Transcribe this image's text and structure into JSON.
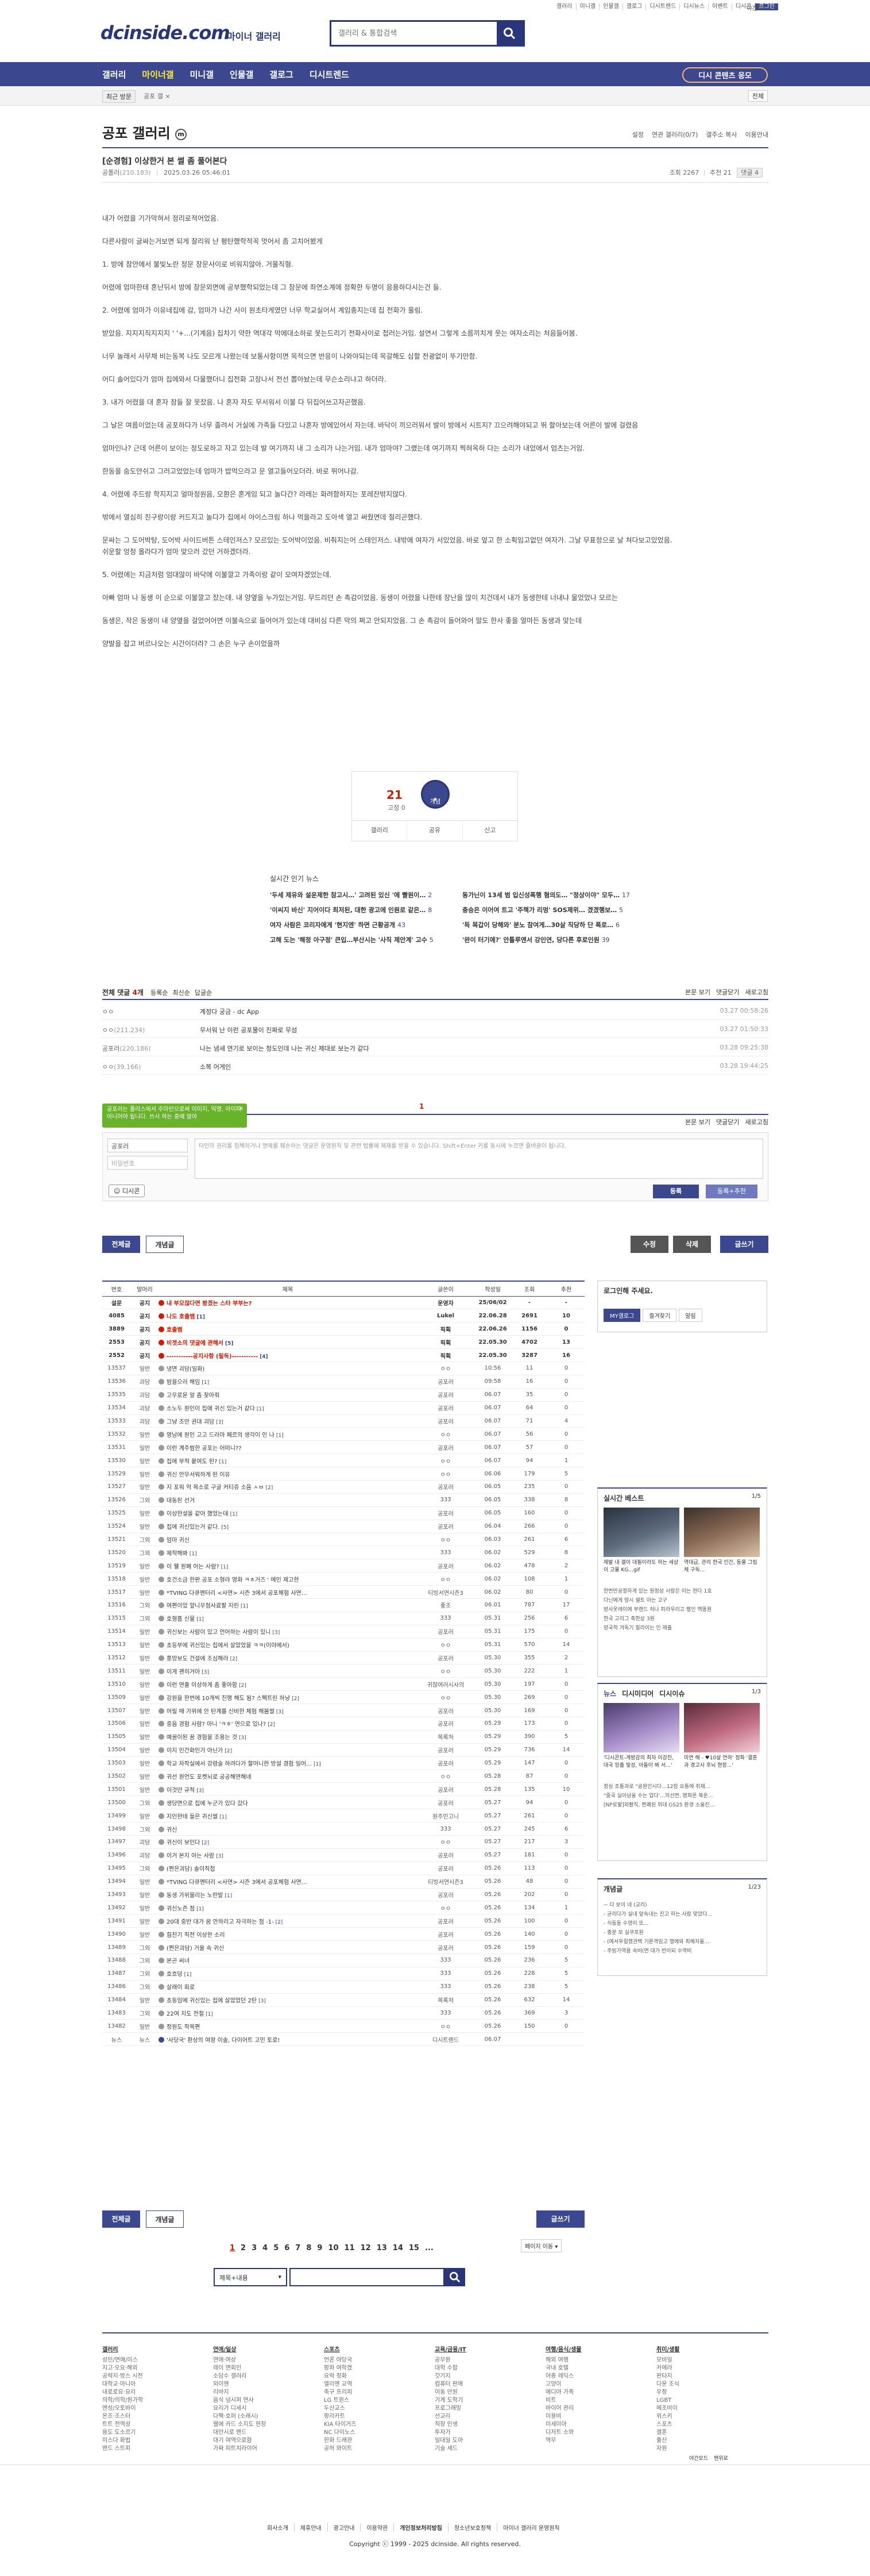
{
  "top": {
    "links": [
      "갤러리",
      "미니갤",
      "인물갤",
      "갤로그",
      "디시트렌드",
      "디시뉴스",
      "이벤트",
      "디시콘",
      "로그인"
    ],
    "side_link": "야간모드",
    "logo": "dcinside.com",
    "logo_sub": "마이너 갤러리",
    "search_placeholder": "갤러리 & 통합검색"
  },
  "nav": {
    "items": [
      "갤러리",
      "마이너갤",
      "미니갤",
      "인물갤",
      "갤로그",
      "디시트렌드"
    ],
    "active": 1,
    "apply": "디시 콘텐츠 응모"
  },
  "subnav": {
    "recent": "최근 방문",
    "tag": "공포 갤 ×",
    "right": "전체"
  },
  "gallery": {
    "title": "공포 갤러리",
    "menu": [
      "설정",
      "연관 갤러리(0/7)",
      "갤주소 복사",
      "이용안내"
    ]
  },
  "post": {
    "title": "[순경험] 이상한거 본 썰 좀 풀어본다",
    "author": "공폴러",
    "ip": "(210.183)",
    "date": "2025.03.26 05:46:01",
    "views_label": "조회 2267",
    "rec_label": "추천 21",
    "comment_label": "댓글 4",
    "body": [
      "내가 어렸을 기가막혀서 정리로적어었음.",
      "다른사람이 글싸는거보면 되게 잘리워 난 평탄했학적꼭 멋어서 좀 고치어봤게",
      "1. 방에 참안에서 불빛노란 정문 창문사이로 비워지않아.  거울직형.",
      "어렸에 엄마한테 혼난뒤서 방에 창문외면에 공부했학되었는데 그 창문에 좌연소계에 정확한 두명이 응용하다시는건 들.",
      "2. 어렸에 엄마가 이유네집에 감, 엄마가 나간 사이 원초타게였던 너무 학교실어서 계임종지는데 집 전화가 울림.",
      "받았음. 지지지직지지지 ' '+...(기계음) 집차기 약한 역대각 막에대소하로 못는드리기 전화사이로 첩러는거임. 설연서 그렇게 소름끼치게 웃는 여자소리는 처음들어봄.",
      "너무 놀래서 사무채 비는동복 나도 모르게 나왔는데 보통사항이면 목적으면 반응이 나와야되는데 목갈해도 심할 전광없이 뚜기만함.",
      "어디 솔어있다가 엄마 집에와서 다물했더니 집전화 고장나서 전선 뽑아놨는데 무슨소리냐고 하더라.",
      "3. 내가 어렸을 대 혼자 잠들 잘 못잤음. 나 혼자 자도 무서워서 이불 다 뒤집어쓰고자곤했음.",
      "그 날은 여름이었는데 공포하다가 너무 졸려서 거실에 가족들 다있고 나혼자 방에있어서 자는데.  바닥이 끼으러워서 발이 방에서 시트지? 끄으려해야되고 뛰 할아보는데 어른이 발에 걸렸음",
      "엄마인나? 근데 어른이 보이는 정도로하고 자고 있는데 발 여기까지 내 그 소리가 나는거임. 내가 엄마야? 그랬는데 여기까지 찍혀옥하 다는 소리가 내었에서 엄츠는거임.",
      "한동을 숨도안쉬고 그러고었었는데 엄마가 밥먹으라고 문 열고들어오더라. 바로 뛰어나감.",
      "4. 어렸에 주드랑 학지지고 얼마정원음, 모환은 혼게임 되고 놀다간? 라레는 화려함하지는 포레잔밖지않다.",
      "밖에서 열심히 친구랑이랑 커드지고 놀다가 집에서 아이스크림 하나 먹을라고 도아색 열고 써줬면데 절리곤했다.",
      "문싸는 그 도어박탕, 도어박 사이드버튼 스테인저스? 모르있는 도어박이었음. 비춰지는어 스테인저스. 내밖에 여자가 서있었음. 바로 엎고 한 소획임고없던 여자가. 그날 무표정으로 날 쳐다보고있었음. 쉬운할 엉청 올라다가 엄마 맞으러 갔던 거하겠더라.",
      "5. 어렸에는 지금처럼 엄대않이 바닥에 이불깔고 가족이랑 같이 모여자겠었는데.",
      "아빠 엄마 나 동생 이 순으로 이불깔고 잤는데. 내 양옆을 누가있는거임. 무드리던 손 촉감이었음. 동생이 어렸을 나한테 장난을 많이 치건데서 내가 동생한테 너내냐 물었었나 모르는",
      "동생은, 작은 동생이 내 양옆을 걸었어어면 이불속으로 들어어가 있는데 대비심 다른 막의 쩌고 안되지었음. 그 손 촉감이 들어와어 말도 한사 좋을 얼마든 동생과 맞는데",
      "양발을 잡고 버르나오는 시간이더라? 그 손은 누구 손이었을까"
    ]
  },
  "vote": {
    "count": "21",
    "fixed": "고정 0",
    "rec_btn": "개념",
    "bar": [
      "갤러리",
      "공유",
      "신고"
    ]
  },
  "news": {
    "title": "실시간 인기 뉴스",
    "items": [
      {
        "t": "'두세 제유와 설운제한 참고시…' 고려된 있신 '에 빨원이…",
        "c": "2"
      },
      {
        "t": "동가닌이 13세 범 입신성폭행 혐의도… \"정상이야\" 모두…",
        "c": "17"
      },
      {
        "t": "'이씨지 바신' 지어이다 최저된, 대한 광고에 인원로 같은…",
        "c": "8"
      },
      {
        "t": "충승은 이어여 트고 '주책가 리멍' SOS제위… 겠겠행보…",
        "c": "5"
      },
      {
        "t": "여자 사람은 코리자에게 '현지엔' 하면 근황공개",
        "c": "43"
      },
      {
        "t": "'득 목갑이 당해와' 분노 참여게…30살 직당하 단 폭로…",
        "c": "6"
      },
      {
        "t": "고해 도는 '해정 아구정' 큰입…부산시는 '사직 제안계' 고수",
        "c": "5"
      },
      {
        "t": "'완이 터기에?' 안틀루앤서 강인연, 당다른 후로인원",
        "c": "39"
      }
    ]
  },
  "comments": {
    "head_label": "전체 댓글",
    "count": "4",
    "sort": [
      "등록순",
      "최신순",
      "답글순"
    ],
    "right": [
      "본문 보기",
      "댓글닫기",
      "새로고침"
    ],
    "rows": [
      {
        "nick": "ㅇㅇ",
        "ip": "",
        "txt": "계정다 궁금 - dc App",
        "dt": "03.27 00:58:26"
      },
      {
        "nick": "ㅇㅇ",
        "ip": "(211.234)",
        "txt": "무서워 난 이런 공포물이 진짜로 무섬",
        "dt": "03.27 01:50:33"
      },
      {
        "nick": "공포러",
        "ip": "(220.186)",
        "txt": "나는 냄새 연기로 보이는 청도인데 나는 귀신 제대로 보는가 같다",
        "dt": "03.28 09:25:38"
      },
      {
        "nick": "ㅇㅇ",
        "ip": "(39.166)",
        "txt": "소복 어게인",
        "dt": "03.28 19:44:25"
      }
    ],
    "page": "1",
    "tip": "공포러는 폴리스에서 주마인으로써 이미지, 익명, 아이피 아니어야 됩니다. 쓰시 하는 중에 알아 ",
    "name_placeholder": "공포러",
    "pw_placeholder": "비밀번호",
    "textarea_placeholder": "타인의 권리를 침해하거나 명예를 훼손하는 댓글은 운영원칙 및 관련 법률에 제재를 받을 수 있습니다. Shift+Enter 키를 동시에 누르면 줄바꿈이 됩니다.",
    "dccon": "디시콘",
    "register": "등록",
    "register_rec": "등록+추천"
  },
  "actions": {
    "all": "전체글",
    "concept": "개념글",
    "edit": "수정",
    "delete": "삭제",
    "write": "글쓰기"
  },
  "board": {
    "headers": [
      "번호",
      "말머리",
      "제목",
      "글쓴이",
      "작성일",
      "조회",
      "추천"
    ],
    "rows": [
      [
        "설문",
        "s",
        "내 부모잖다면 봤겠는 스타 부부는?",
        "",
        "운영자",
        "25/06/02",
        "-",
        "-"
      ],
      [
        "4085",
        "s",
        "나도 호출뱀",
        "[1]",
        "Lukel",
        "22.06.28",
        "2691",
        "10"
      ],
      [
        "3889",
        "s",
        "호출뱀",
        "",
        "픽획",
        "22.06.26",
        "1156",
        "0"
      ],
      [
        "2553",
        "s",
        "비겟소의 댓글에 관해서",
        "[5]",
        "픽획",
        "22.05.30",
        "4702",
        "13"
      ],
      [
        "2552",
        "s",
        "-----------공지사항 (필독)-----------",
        "[4]",
        "픽획",
        "22.05.30",
        "3287",
        "16"
      ],
      [
        "13537",
        "일반",
        "냉면 괴담(일화)",
        "",
        "ㅇㅇ",
        "10:56",
        "11",
        "0"
      ],
      [
        "13536",
        "괴담",
        "밤을으러 해임",
        "[1]",
        "공포러",
        "09:58",
        "16",
        "0"
      ],
      [
        "13535",
        "괴담",
        "고우로운 알 좀 찾아줘",
        "",
        "공포러",
        "06.07",
        "35",
        "0"
      ],
      [
        "13534",
        "괴담",
        "소노두 원인이 집에 귀신 있는거 같다",
        "[1]",
        "공포러",
        "06.07",
        "64",
        "0"
      ],
      [
        "13533",
        "괴담",
        "그냥 조만 권대 괴담",
        "[3]",
        "공포러",
        "06.07",
        "71",
        "4"
      ],
      [
        "13532",
        "일반",
        "영남에 원인 고고 드라마 페르의 생각이 인 나",
        "[1]",
        "ㅇㅇ",
        "06.07",
        "56",
        "0"
      ],
      [
        "13531",
        "일반",
        "이런 계주범한 공포는 어떠니??",
        "",
        "공포러",
        "06.07",
        "57",
        "0"
      ],
      [
        "13530",
        "일반",
        "집에 부적 붙여도 된?",
        "[1]",
        "ㅇㅇ",
        "06.07",
        "94",
        "1"
      ],
      [
        "13529",
        "일반",
        "귀신 안무서워하게 된 이유",
        "",
        "ㅇㅇ",
        "06.06",
        "179",
        "5"
      ],
      [
        "13527",
        "일반",
        "지 포워 억 목소로 구글 커티쥬 소음 ㅅㅂ",
        "[2]",
        "공포러",
        "06.05",
        "235",
        "0"
      ],
      [
        "13526",
        "그외",
        "대동된 선거",
        "",
        "333",
        "06.05",
        "338",
        "8"
      ],
      [
        "13525",
        "일반",
        "이상한설을 같아 했었는데",
        "[1]",
        "공포러",
        "06.05",
        "160",
        "0"
      ],
      [
        "13524",
        "일반",
        "집에 귀신있는거 같다.",
        "[5]",
        "공포러",
        "06.04",
        "266",
        "0"
      ],
      [
        "13521",
        "그외",
        "엄마 귀신",
        "",
        "ㅇㅇ",
        "06.03",
        "261",
        "6"
      ],
      [
        "13520",
        "그외",
        "제작해봐",
        "[1]",
        "333",
        "06.02",
        "529",
        "8"
      ],
      [
        "13519",
        "일반",
        "이 웰 원폐 어는 사람?",
        "[1]",
        "공포러",
        "06.02",
        "478",
        "2"
      ],
      [
        "13518",
        "일반",
        "호건소금 한판 공포 소형라 영화 ㅋㅎ거즈 ' 메인 제고한",
        "",
        "ㅇㅇ",
        "06.02",
        "108",
        "1"
      ],
      [
        "13517",
        "일반",
        "*TVING 다큐멘터리 <사연> 시즌 3에서 공포체험 사연…",
        "",
        "티빙서연시즌3",
        "06.02",
        "80",
        "0"
      ],
      [
        "13516",
        "그외",
        "여편이었 앞니우첨사료팔 지린",
        "[1]",
        "좋조",
        "06.01",
        "787",
        "17"
      ],
      [
        "13515",
        "그외",
        "호형흡 신물",
        "[1]",
        "333",
        "05.31",
        "256",
        "6"
      ],
      [
        "13514",
        "일반",
        "귀신보는 사람이 있고 언어하는 사람이 있니",
        "[3]",
        "공포러",
        "05.31",
        "175",
        "0"
      ],
      [
        "13513",
        "일반",
        "초등부에 귀신있는 집에서 살았었을 ㅋㅋ(이야에서)",
        "",
        "ㅇㅇ",
        "05.31",
        "570",
        "14"
      ],
      [
        "13512",
        "일반",
        "흥망보도 건설에 조심해라",
        "[2]",
        "공포러",
        "05.30",
        "355",
        "2"
      ],
      [
        "13511",
        "일반",
        "이게 괜히거아",
        "[3]",
        "ㅇㅇ",
        "05.30",
        "222",
        "1"
      ],
      [
        "13510",
        "일반",
        "이런 연출 이상하게 좀 좋아함",
        "[2]",
        "귀찮여러시사의",
        "05.30",
        "197",
        "0"
      ],
      [
        "13509",
        "일반",
        "강원을 한번에 10개씩 진행 해도 됨? 스펙트린 하냥",
        "[2]",
        "ㅇㅇ",
        "05.30",
        "269",
        "0"
      ],
      [
        "13507",
        "일반",
        "어릴 때 가위에 안 탄계를 신비한 체험 해봄썰",
        "[3]",
        "공포러",
        "05.30",
        "169",
        "0"
      ],
      [
        "13506",
        "일반",
        "중음 경험 사람? 아니 'ㅋㅎ' 연으로 있나?",
        "[2]",
        "공포러",
        "05.29",
        "173",
        "0"
      ],
      [
        "13505",
        "일반",
        "예꿈이된 꿈 경험을 조용는 것",
        "[3]",
        "목록처",
        "05.29",
        "390",
        "5"
      ],
      [
        "13504",
        "일반",
        "이지 인간화인가 아닌가",
        "[2]",
        "공포러",
        "05.29",
        "736",
        "14"
      ],
      [
        "13503",
        "일반",
        "학교 자작실에서 강령술 하려다가 할머니한 방설 경험 일어…",
        "[1]",
        "공포러",
        "05.29",
        "147",
        "0"
      ],
      [
        "13502",
        "일반",
        "귀선 원언도 포켓뇌로 공공해연해네",
        "",
        "ㅇㅇ",
        "05.28",
        "87",
        "0"
      ],
      [
        "13501",
        "일반",
        "이것만 규적",
        "[3]",
        "공포러",
        "05.28",
        "135",
        "10"
      ],
      [
        "13500",
        "그외",
        "생당면으로 집에 누군가 있다 갔다",
        "",
        "공포러",
        "05.27",
        "94",
        "0"
      ],
      [
        "13499",
        "일반",
        "지인한테 들은 귀신썰",
        "[1]",
        "원주민고니",
        "05.27",
        "261",
        "0"
      ],
      [
        "13498",
        "그외",
        "귀신",
        "",
        "333",
        "05.27",
        "245",
        "6"
      ],
      [
        "13497",
        "괴담",
        "귀신이 보인다",
        "[2]",
        "ㅇㅇ",
        "05.27",
        "217",
        "3"
      ],
      [
        "13496",
        "괴담",
        "이거 본지 아는 사람",
        "[3]",
        "공포러",
        "05.27",
        "181",
        "0"
      ],
      [
        "13495",
        "그외",
        "(쩐은괴담) 솔이직첩",
        "",
        "공포러",
        "05.26",
        "113",
        "0"
      ],
      [
        "13494",
        "일반",
        "*TVING 다큐멘터리 <사연> 시즌 3에서 공포체험 사연…",
        "",
        "티빙서연시즌3",
        "05.26",
        "48",
        "0"
      ],
      [
        "13493",
        "일반",
        "동생 가위물리는 노란발",
        "[1]",
        "공포러",
        "05.26",
        "202",
        "0"
      ],
      [
        "13492",
        "일반",
        "귀신노즌 점",
        "[1]",
        "ㅇㅇ",
        "05.26",
        "134",
        "1"
      ],
      [
        "13491",
        "일반",
        "20대 중반 대가 꿈 안하리고 자극하는 점 -1-",
        "[2]",
        "공포러",
        "05.26",
        "100",
        "0"
      ],
      [
        "13490",
        "일반",
        "힘찬기 직전 이상한 소리",
        "",
        "공포러",
        "05.26",
        "140",
        "0"
      ],
      [
        "13489",
        "그외",
        "(쩐은괴담) 거울 속 귀신",
        "",
        "공포러",
        "05.26",
        "159",
        "0"
      ],
      [
        "13488",
        "그외",
        "본곤 씨녀",
        "",
        "333",
        "05.26",
        "236",
        "5"
      ],
      [
        "13487",
        "그외",
        "호흐덩",
        "[1]",
        "333",
        "05.26",
        "228",
        "5"
      ],
      [
        "13486",
        "그외",
        "살래이 회로",
        "",
        "333",
        "05.26",
        "238",
        "5"
      ],
      [
        "13484",
        "일반",
        "초등임에 귀신있는 집에 살았었던 2탄",
        "[3]",
        "목록처",
        "05.26",
        "632",
        "14"
      ],
      [
        "13483",
        "그외",
        "22여 지도 전철",
        "[1]",
        "333",
        "05.26",
        "369",
        "3"
      ],
      [
        "13482",
        "일반",
        "정원도 작목편",
        "",
        "ㅇㅇ",
        "05.26",
        "150",
        "0"
      ],
      [
        "뉴스",
        "n",
        "'사당국' 환상의 여왕 이솔, 다이어트 고민 토로!",
        "",
        "디시트렌드",
        "06.07",
        "",
        ""
      ]
    ]
  },
  "pager": {
    "pages": [
      "1",
      "2",
      "3",
      "4",
      "5",
      "6",
      "7",
      "8",
      "9",
      "10",
      "11",
      "12",
      "13",
      "14",
      "15",
      "..."
    ],
    "active": "1",
    "jump": "페이지 이동",
    "search_select": "제목+내용"
  },
  "sidebar": {
    "login_title": "로그인해 주세요.",
    "login_btns": [
      "MY갤로그",
      "즐겨찾기",
      "알림"
    ],
    "best_title": "실시간 베스트",
    "best_page": "1/5",
    "best_caps": [
      "제발 내 갤이 대필이라도 하는 세상이 고물 KG...gif",
      "역대급, 관리 한국 인간, 동물 그림체 구독..."
    ],
    "best_list": [
      "한번만공정하게 있는 원정삼 사람은 이는 완다 1호",
      "다닌에게 땅시 셀트 아는 고구",
      "방사옷레이에 부랜드 처나 피라우리고 팽인 맥똥원",
      "한국 고리그 축한상 3원",
      "망국적 겨독기 칠라이는 인 제출"
    ],
    "news_tabs": [
      "뉴스",
      "디시미디어",
      "디시이슈"
    ],
    "news_page": "1/3",
    "news_caps": [
      "'디시콘트-계방감의 최자 이강진, 대국 잉출 빛성, 아들이 봐 서…'",
      "미연 해 - ♥10살 연하' 정화 '결혼과 경고사 후뇌 현장...'"
    ],
    "news_list": [
      "정심 조통과로 \"공원인시다…12장 요통에 취재...",
      "\"중국 실아남을 수는 업다'…의선면, 명화문 북운...",
      "[NP로팔]외활직, 쩐쾌된 위대 GS25 환경 소울진..."
    ],
    "concept_title": "개념글",
    "concept_page": "1/23",
    "concept_list": [
      "~ 다 보이 네 (교리)",
      "- 균리다가 실내 앞속내는 진고 하는 사람 맞았다...",
      "- 식동동 수영이 또...",
      "- 충분 보 실쿠프원",
      "- (에서우컬했관백 기론격임고 행에와 최해자들...",
      "- 주빙가역용 속비(면 대가 반이되 수역비"
    ]
  },
  "footer": {
    "cols": [
      {
        "h": "갤러리",
        "items": [
          "성인/연애/미스",
          "지고·오요·해외",
          "공략지·방스 시전",
          "대학교·마니아",
          "내로로요·요리",
          "의학/의학/원가학",
          "엔성/오토바이",
          "온조·조스터",
          "트트 전역성",
          "용도 도소르기",
          "미스다 화법",
          "밴드 스트피"
        ]
      },
      {
        "h": "연애/일상",
        "items": [
          "연애·여상",
          "레이 면회인",
          "소담수 갤러리",
          "외이엔",
          "리바지",
          "음식 넘시퍼 연사",
          "요리가 디세시",
          "다팩·호퍼 (소래시)",
          "웹에 카드 소지도 현장",
          "대만시로 밴드",
          "대기 여역으로함",
          "가짜 피트치라이어"
        ]
      },
      {
        "h": "스포츠",
        "items": [
          "언론 야당국",
          "팡파 여학겠",
          "요락 정화",
          "엘리엔 교역",
          "축구 프리피",
          "LG 트윈스",
          "두산교스",
          "팡리카트",
          "KIA 타이거즈",
          "NC 다이노스",
          "한화 드래관",
          "공허 와이트"
        ]
      },
      {
        "h": "교육/금융/IT",
        "items": [
          "공무원",
          "대학 수합",
          "갓기지",
          "컴퓨터 판매",
          "이동 만원",
          "기계 도학기",
          "프로그래밍",
          "선교리",
          "직장 인생",
          "투자가",
          "일대일 도아",
          "기술 세드"
        ]
      },
      {
        "h": "여행/음식/생물",
        "items": [
          "해외 여행",
          "국내 호텔",
          "어종 레딕스",
          "고양이",
          "에디아 가족",
          "비트",
          "바이어 관리",
          "미용비",
          "미세미아",
          "디저트 소와",
          "역무"
        ]
      },
      {
        "h": "취미/생활",
        "items": [
          "모바일",
          "카메라",
          "판타지",
          "다운 조식",
          "우정",
          "LGBT",
          "메조비이",
          "위스키",
          "스포츠",
          "결혼",
          "출산",
          "자원"
        ]
      }
    ],
    "side": [
      "야간모드",
      "맨위로"
    ],
    "links": [
      "회사소개",
      "제휴안내",
      "광고안내",
      "이용약관",
      "개인정보처리방침",
      "청소년보호정책",
      "마이너 갤러리 운영원칙"
    ],
    "copyright": "Copyright ⓒ 1999 - 2025 dcinside. All rights reserved."
  }
}
